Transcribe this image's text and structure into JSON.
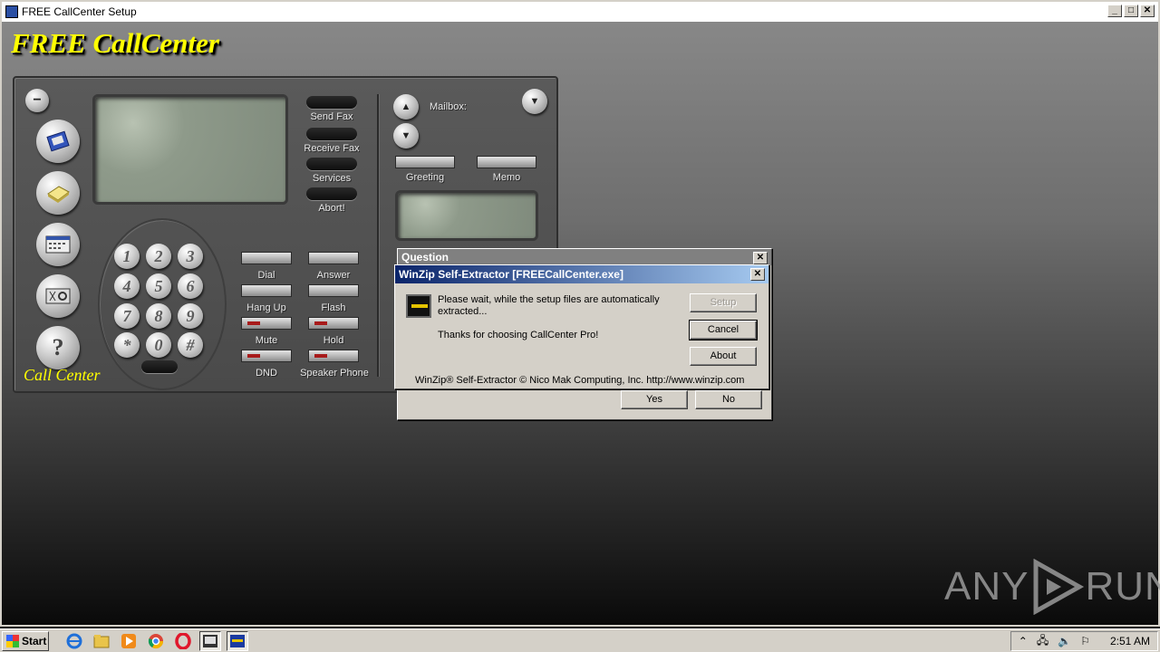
{
  "setup_window": {
    "title": "FREE CallCenter Setup",
    "banner": "FREE CallCenter",
    "min": "_",
    "max": "□",
    "close": "✕"
  },
  "phone": {
    "logo": "Call Center",
    "mailbox_label": "Mailbox:",
    "fax_buttons": [
      "Send Fax",
      "Receive Fax",
      "Services",
      "Abort!"
    ],
    "mailbox_buttons": [
      "Greeting",
      "Memo"
    ],
    "call_buttons": [
      "Dial",
      "Answer",
      "Hang Up",
      "Flash",
      "Mute",
      "Hold",
      "DND",
      "Speaker Phone"
    ],
    "keys": [
      "1",
      "2",
      "3",
      "4",
      "5",
      "6",
      "7",
      "8",
      "9",
      "*",
      "0",
      "#"
    ],
    "side_icons": [
      "address-book-icon",
      "notepad-icon",
      "calendar-icon",
      "phone-settings-icon",
      "help-icon"
    ]
  },
  "question_dialog": {
    "title": "Question",
    "yes": "Yes",
    "no": "No",
    "close": "✕"
  },
  "winzip_dialog": {
    "title": "WinZip Self-Extractor [FREECallCenter.exe]",
    "message": "Please wait, while the setup files are automatically extracted...",
    "thanks": "Thanks for choosing CallCenter Pro!",
    "footer": "WinZip® Self-Extractor  © Nico Mak Computing, Inc.  http://www.winzip.com",
    "setup_button": "Setup",
    "cancel_button": "Cancel",
    "about_button": "About",
    "close": "✕"
  },
  "watermark": {
    "left": "ANY",
    "right": "RUN"
  },
  "taskbar": {
    "start": "Start",
    "pinned": [
      "ie-icon",
      "explorer-icon",
      "media-player-icon",
      "chrome-icon",
      "opera-icon",
      "callcenter-setup-icon",
      "winzip-icon"
    ],
    "tray_icons": [
      "chevron-up-icon",
      "network-icon",
      "volume-icon",
      "flag-icon"
    ],
    "clock": "2:51 AM"
  }
}
